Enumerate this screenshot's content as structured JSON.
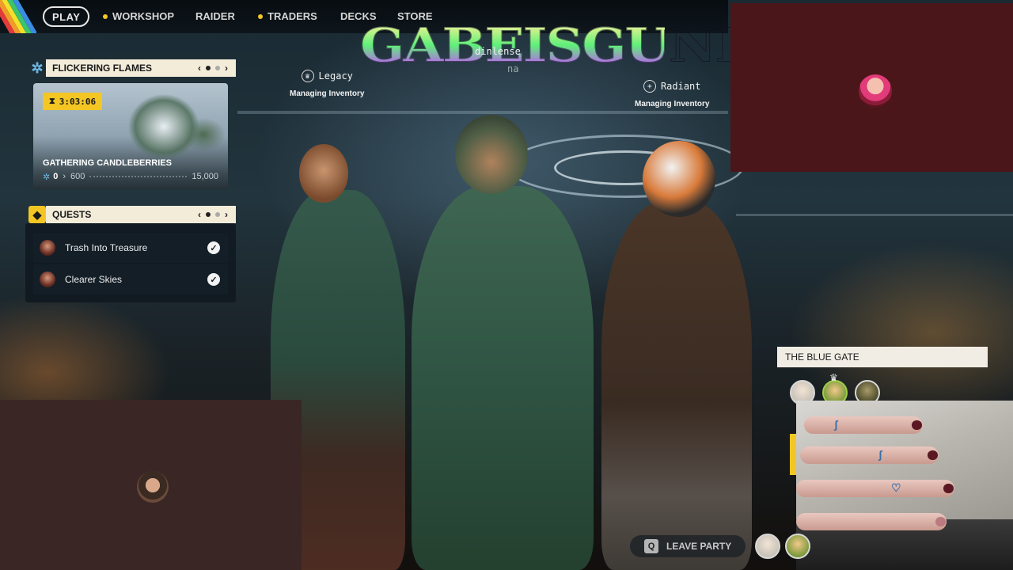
{
  "nav": {
    "play": "PLAY",
    "workshop": "WORKSHOP",
    "raider": "RAIDER",
    "traders": "TRADERS",
    "decks": "DECKS",
    "store": "STORE"
  },
  "logo": {
    "text": "GABEISGUNK",
    "fragment_1": "dinlense",
    "fragment_2": "na"
  },
  "party": [
    {
      "name": "Legacy",
      "badge_icon": "crown-icon",
      "status": "Managing Inventory"
    },
    {
      "name": "Radiant",
      "badge_icon": "plus-icon",
      "status": "Managing Inventory"
    }
  ],
  "event": {
    "title": "FLICKERING FLAMES",
    "timer": "3:03:06",
    "card_title": "GATHERING CANDLEBERRIES",
    "progress_current": "0",
    "progress_next": "600",
    "progress_max": "15,000",
    "progress_fraction": 0,
    "page_arrow_left": "‹",
    "page_arrow_right": "›"
  },
  "quests": {
    "title": "QUESTS",
    "items": [
      {
        "label": "Trash Into Treasure",
        "completed": true
      },
      {
        "label": "Clearer Skies",
        "completed": true
      }
    ],
    "page_arrow_left": "‹",
    "page_arrow_right": "›"
  },
  "blue_gate": {
    "title": "THE BLUE GATE"
  },
  "leave_party": {
    "key": "Q",
    "label": "LEAVE PARTY"
  },
  "colors": {
    "accent_yellow": "#f3c623",
    "panel_cream": "#f3ecd9",
    "cam_top_bg": "#4b1619",
    "cam_bottom_bg": "#3a2624"
  }
}
